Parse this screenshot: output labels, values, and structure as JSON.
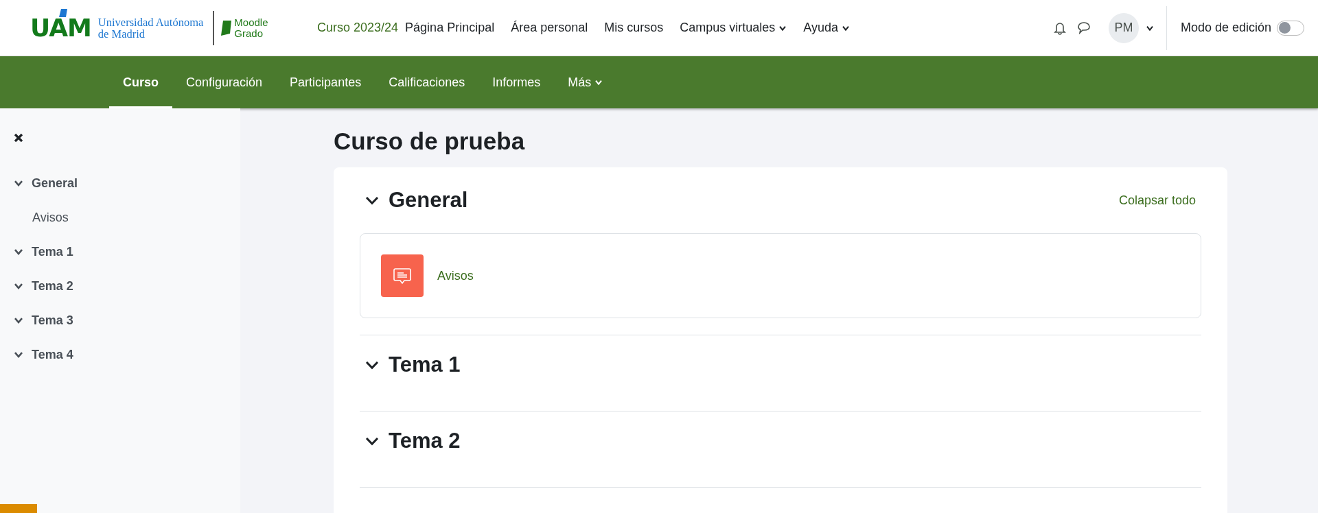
{
  "header": {
    "logo": {
      "mark": "UAM",
      "line_1": "Universidad Autónoma",
      "line_2": "de Madrid",
      "sub_1": "Moodle",
      "sub_2": "Grado"
    },
    "course_year": "Curso 2023/24",
    "nav": [
      {
        "label": "Página Principal",
        "dropdown": false
      },
      {
        "label": "Área personal",
        "dropdown": false
      },
      {
        "label": "Mis cursos",
        "dropdown": false
      },
      {
        "label": "Campus virtuales",
        "dropdown": true
      },
      {
        "label": "Ayuda",
        "dropdown": true
      }
    ],
    "avatar": "PM",
    "edit_mode": {
      "label": "Modo de edición",
      "on": false
    }
  },
  "tabs": [
    {
      "label": "Curso",
      "selected": true,
      "dropdown": false
    },
    {
      "label": "Configuración",
      "selected": false,
      "dropdown": false
    },
    {
      "label": "Participantes",
      "selected": false,
      "dropdown": false
    },
    {
      "label": "Calificaciones",
      "selected": false,
      "dropdown": false
    },
    {
      "label": "Informes",
      "selected": false,
      "dropdown": false
    },
    {
      "label": "Más",
      "selected": false,
      "dropdown": true
    }
  ],
  "sidebar": {
    "items": [
      {
        "label": "General",
        "children": [
          {
            "label": "Avisos"
          }
        ]
      },
      {
        "label": "Tema 1"
      },
      {
        "label": "Tema 2"
      },
      {
        "label": "Tema 3"
      },
      {
        "label": "Tema 4"
      }
    ]
  },
  "page_title": "Curso de prueba",
  "collapse_all": "Colapsar todo",
  "sections": [
    {
      "title": "General",
      "activities": [
        {
          "label": "Avisos"
        }
      ]
    },
    {
      "title": "Tema 1"
    },
    {
      "title": "Tema 2"
    }
  ]
}
